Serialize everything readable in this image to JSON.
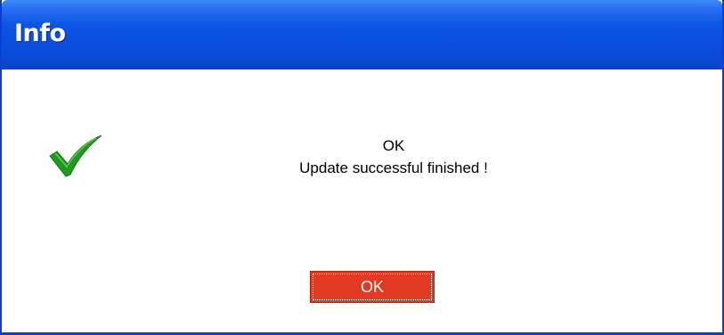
{
  "dialog": {
    "title": "Info",
    "message_status": "OK",
    "message_detail": "Update successful finished !",
    "ok_label": "OK",
    "icon": "checkmark-icon"
  },
  "colors": {
    "titlebar": "#0a4fdc",
    "button": "#e23a22",
    "checkmark": "#1a9a1a"
  }
}
